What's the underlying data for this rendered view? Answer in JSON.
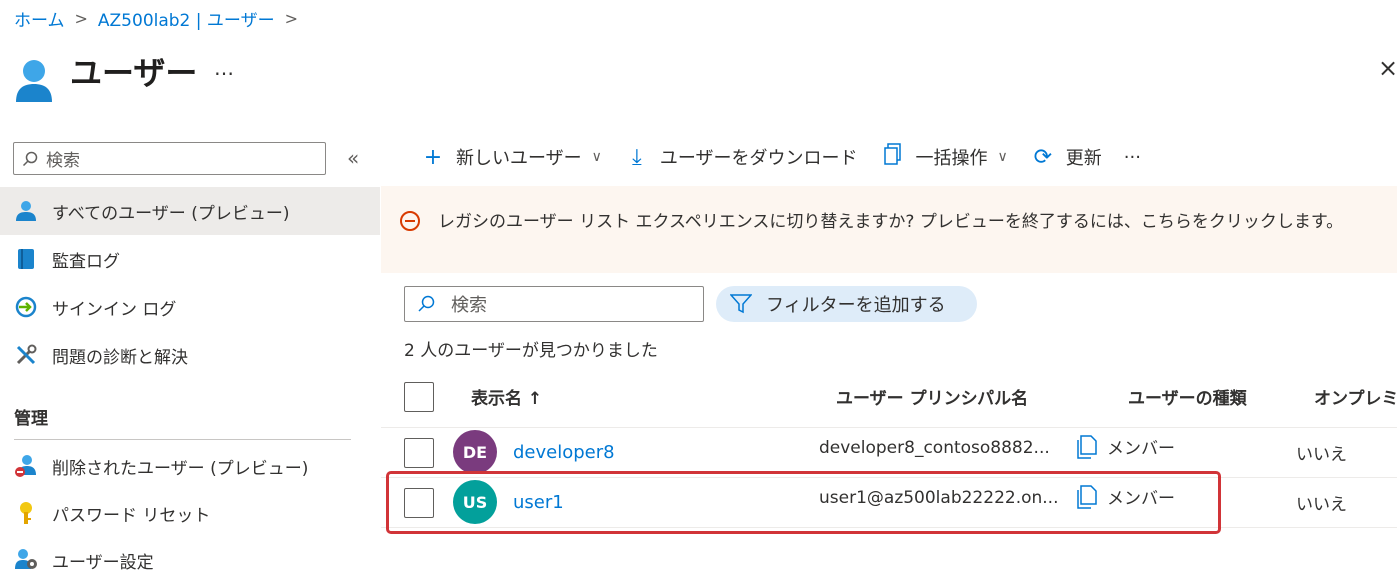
{
  "breadcrumb": {
    "home": "ホーム",
    "tenant": "AZ500lab2 | ユーザー"
  },
  "page": {
    "title": "ユーザー",
    "more": "…",
    "close": "×"
  },
  "sidebar": {
    "search_placeholder": "検索",
    "collapse": "«",
    "items": [
      {
        "label": "すべてのユーザー (プレビュー)",
        "icon": "user-icon",
        "active": true
      },
      {
        "label": "監査ログ",
        "icon": "book-icon"
      },
      {
        "label": "サインイン ログ",
        "icon": "sign-in-icon"
      },
      {
        "label": "問題の診断と解決",
        "icon": "wrench-icon"
      }
    ],
    "section_title": "管理",
    "manage_items": [
      {
        "label": "削除されたユーザー (プレビュー)",
        "icon": "user-deleted-icon"
      },
      {
        "label": "パスワード リセット",
        "icon": "key-icon"
      },
      {
        "label": "ユーザー設定",
        "icon": "user-settings-icon"
      }
    ]
  },
  "toolbar": {
    "new_user": "新しいユーザー",
    "download": "ユーザーをダウンロード",
    "bulk": "一括操作",
    "refresh": "更新",
    "more": "···"
  },
  "banner": {
    "text": "レガシのユーザー リスト エクスペリエンスに切り替えますか? プレビューを終了するには、こちらをクリックします。"
  },
  "filters": {
    "search_placeholder": "検索",
    "add_filter": "フィルターを追加する",
    "result_count": "2 人のユーザーが見つかりました"
  },
  "table": {
    "headers": {
      "display_name": "表示名 ↑",
      "upn": "ユーザー プリンシパル名",
      "type": "ユーザーの種類",
      "onprem": "オンプレミ"
    },
    "rows": [
      {
        "initials": "DE",
        "name": "developer8",
        "upn": "developer8_contoso8882...",
        "type": "メンバー",
        "onprem": "いいえ",
        "avatar_color": "#7a3b7e"
      },
      {
        "initials": "US",
        "name": "user1",
        "upn": "user1@az500lab22222.on...",
        "type": "メンバー",
        "onprem": "いいえ",
        "avatar_color": "#03a09b"
      }
    ]
  },
  "colors": {
    "accent": "#0078d4",
    "highlight": "#d13438",
    "banner_bg": "#fdf6f0",
    "warning": "#d83b01"
  }
}
